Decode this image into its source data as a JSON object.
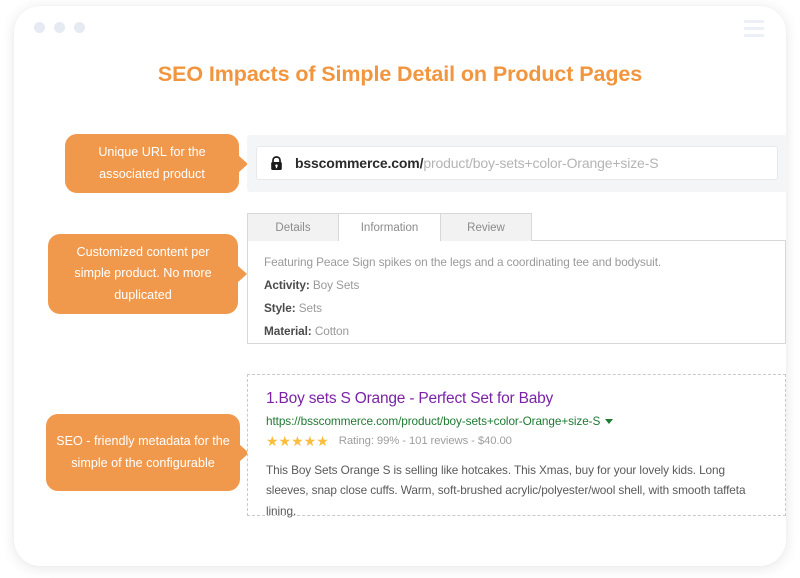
{
  "window": {
    "dots_count": 3,
    "menu_icon": "hamburger-icon"
  },
  "header": {
    "title": "SEO Impacts of Simple Detail on Product Pages",
    "title_color": "#f1953f"
  },
  "callouts": [
    {
      "id": "url",
      "text": "Unique URL for the associated product"
    },
    {
      "id": "content",
      "text": "Customized content per simple product. No more duplicated"
    },
    {
      "id": "seo",
      "text": "SEO - friendly metadata for the simple of the configurable"
    }
  ],
  "address_bar": {
    "lock_icon": "lock-icon",
    "domain": "bsscommerce.com/",
    "path": "product/boy-sets+color-Orange+size-S"
  },
  "product_tabs": {
    "items": [
      {
        "label": "Details",
        "active": false
      },
      {
        "label": "Information",
        "active": true
      },
      {
        "label": "Review",
        "active": false
      }
    ]
  },
  "product_details": {
    "intro": "Featuring Peace Sign spikes on the legs and a coordinating tee and bodysuit.",
    "specs": [
      {
        "label": "Activity:",
        "value": "Boy Sets"
      },
      {
        "label": "Style:",
        "value": "Sets"
      },
      {
        "label": "Material:",
        "value": "Cotton"
      }
    ]
  },
  "serp_result": {
    "title": "1.Boy sets S Orange - Perfect Set for Baby",
    "url": "https://bsscommerce.com/product/boy-sets+color-Orange+size-S",
    "stars": "★★★★★",
    "rating_text": "Rating: 99% - 101 reviews - $40.00",
    "rating_percent": "99%",
    "reviews_count": "101",
    "price": "$40.00",
    "description": "This Boy Sets Orange S is selling like hotcakes. This Xmas, buy for your lovely kids. Long sleeves, snap close cuffs. Warm, soft-brushed acrylic/polyester/wool shell, with smooth taffeta lining."
  },
  "colors": {
    "accent_orange": "#f0994c",
    "serp_title_purple": "#7b23a7",
    "serp_url_green": "#1f7a33",
    "star_yellow": "#fbbd3d"
  }
}
